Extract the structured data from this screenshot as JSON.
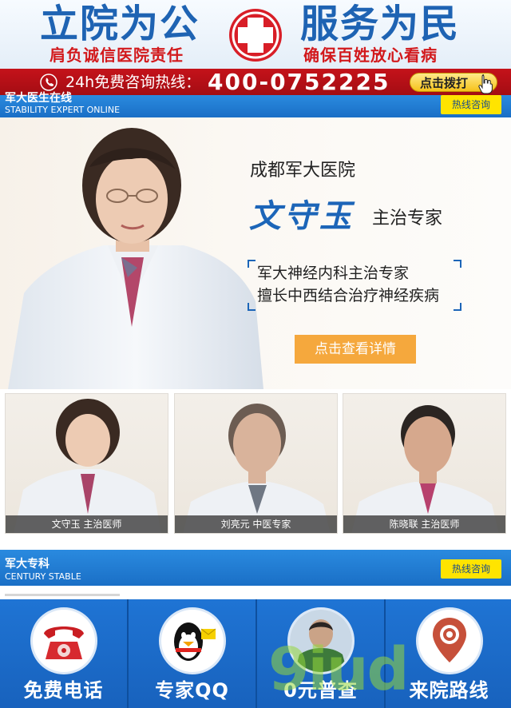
{
  "banner": {
    "slogan_left": "立院为公",
    "slogan_right": "服务为民",
    "sub_left": "肩负诚信医院责任",
    "sub_right": "确保百姓放心看病",
    "colors": {
      "blue": "#1e63b3",
      "red": "#d2191c"
    },
    "center_icon": "red-cross-icon"
  },
  "hotline": {
    "label": "24h免费咨询热线：",
    "number": "400-0752225",
    "dial_button": "点击拨打",
    "icons": [
      "phone-icon",
      "hand-cursor-icon"
    ]
  },
  "section1": {
    "title": "军大医生在线",
    "subtitle": "STABILITY EXPERT ONLINE",
    "button": "热线咨询"
  },
  "hero": {
    "hospital": "成都军大医院",
    "doctor_name": "文守玉",
    "role": "主治专家",
    "intro_line1": "军大神经内科主治专家",
    "intro_line2": "擅长中西结合治疗神经疾病",
    "detail_button": "点击查看详情"
  },
  "doctors": [
    {
      "caption": "文守玉 主治医师"
    },
    {
      "caption": "刘亮元 中医专家"
    },
    {
      "caption": "陈晓联 主治医师"
    }
  ],
  "section2": {
    "title": "军大专科",
    "subtitle": "CENTURY STABLE",
    "button": "热线咨询"
  },
  "bottom_nav": [
    {
      "label": "免费电话",
      "icon": "telephone-icon"
    },
    {
      "label": "专家QQ",
      "icon": "qq-penguin-icon"
    },
    {
      "label": "0元普查",
      "icon": "doctor-avatar-icon"
    },
    {
      "label": "来院路线",
      "icon": "map-pin-icon"
    }
  ],
  "watermark": "9iud"
}
